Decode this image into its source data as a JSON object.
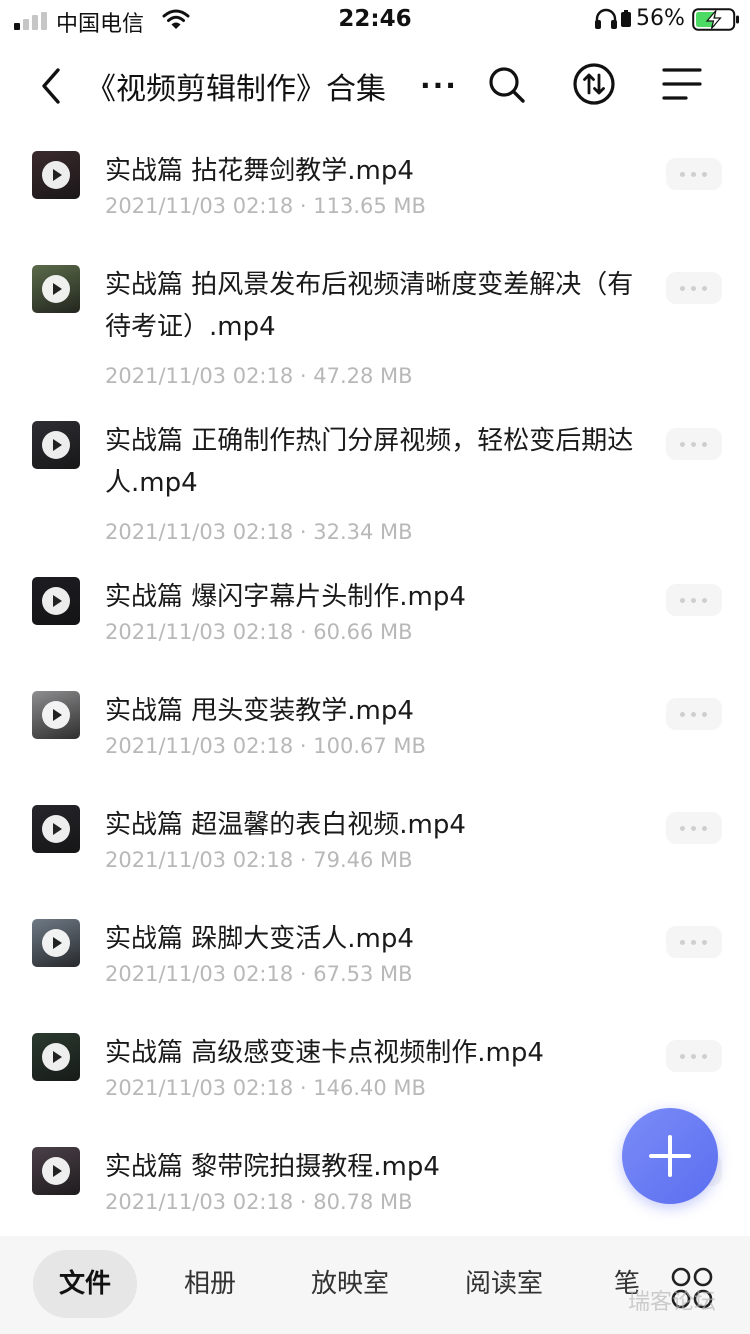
{
  "status_bar": {
    "carrier": "中国电信",
    "time": "22:46",
    "battery_percent": "56%",
    "battery_level": 0.56,
    "signal_bars_active": 1,
    "signal_bars_total": 4
  },
  "nav": {
    "title": "《视频剪辑制作》合集",
    "ellipsis": "...",
    "icons": [
      "back-arrow-icon",
      "search-icon",
      "transfer-icon",
      "menu-icon"
    ]
  },
  "files": [
    {
      "name": "实战篇 拈花舞剑教学.mp4",
      "meta": "2021/11/03 02:18 · 113.65 MB",
      "thumb_color": "#3a2a2e"
    },
    {
      "name": "实战篇 拍风景发布后视频清晰度变差解决（有待考证）.mp4",
      "meta": "2021/11/03 02:18 · 47.28 MB",
      "thumb_color": "#5b6b4a"
    },
    {
      "name": "实战篇 正确制作热门分屏视频，轻松变后期达人.mp4",
      "meta": "2021/11/03 02:18 · 32.34 MB",
      "thumb_color": "#2e2e33"
    },
    {
      "name": "实战篇 爆闪字幕片头制作.mp4",
      "meta": "2021/11/03 02:18 · 60.66 MB",
      "thumb_color": "#1d1d22"
    },
    {
      "name": "实战篇 甩头变装教学.mp4",
      "meta": "2021/11/03 02:18 · 100.67 MB",
      "thumb_color": "#8e8e90"
    },
    {
      "name": "实战篇 超温馨的表白视频.mp4",
      "meta": "2021/11/03 02:18 · 79.46 MB",
      "thumb_color": "#26262b"
    },
    {
      "name": "实战篇 跺脚大变活人.mp4",
      "meta": "2021/11/03 02:18 · 67.53 MB",
      "thumb_color": "#6f7a86"
    },
    {
      "name": "实战篇 高级感变速卡点视频制作.mp4",
      "meta": "2021/11/03 02:18 · 146.40 MB",
      "thumb_color": "#2b3a2f"
    },
    {
      "name": "实战篇 黎带院拍摄教程.mp4",
      "meta": "2021/11/03 02:18 · 80.78 MB",
      "thumb_color": "#4b4048"
    }
  ],
  "tabs": [
    {
      "label": "文件",
      "active": true
    },
    {
      "label": "相册",
      "active": false
    },
    {
      "label": "放映室",
      "active": false
    },
    {
      "label": "阅读室",
      "active": false
    },
    {
      "label": "笔",
      "active": false
    }
  ],
  "watermark": "瑞客论坛",
  "colors": {
    "accent": "#6275f2",
    "meta_text": "#b8b8b8",
    "tab_bar_bg": "#f6f6f6"
  }
}
